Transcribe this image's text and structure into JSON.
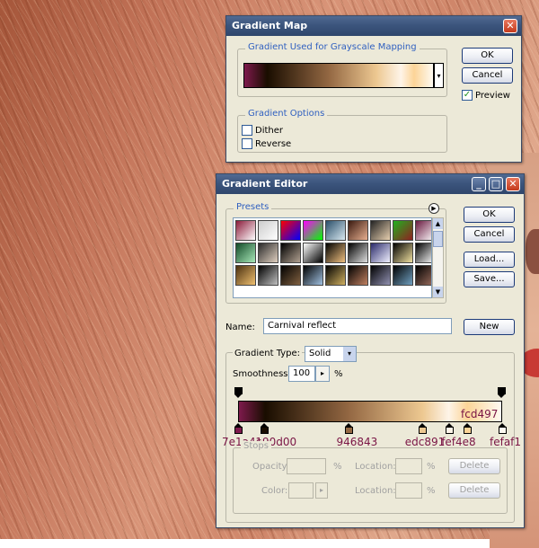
{
  "gradient_map": {
    "title": "Gradient Map",
    "used_label": "Gradient Used for Grayscale Mapping",
    "ok": "OK",
    "cancel": "Cancel",
    "preview_label": "Preview",
    "preview_checked": true,
    "options_label": "Gradient Options",
    "dither_label": "Dither",
    "dither_checked": false,
    "reverse_label": "Reverse",
    "reverse_checked": false
  },
  "gradient_editor": {
    "title": "Gradient Editor",
    "presets_label": "Presets",
    "ok": "OK",
    "cancel": "Cancel",
    "load": "Load...",
    "save": "Save...",
    "name_label": "Name:",
    "name_value": "Carnival reflect",
    "new_button": "New",
    "type_label": "Gradient Type:",
    "type_value": "Solid",
    "smoothness_label": "Smoothness:",
    "smoothness_value": "100",
    "percent": "%",
    "stops_label": "Stops",
    "opacity_label": "Opacity:",
    "color_label": "Color:",
    "location_label": "Location:",
    "delete_label": "Delete"
  },
  "color_stops": [
    {
      "label": "7e1a4c",
      "color": "#7e1a4c"
    },
    {
      "label": "190d00",
      "color": "#190d00"
    },
    {
      "label": "946843",
      "color": "#946843"
    },
    {
      "label": "edc891",
      "color": "#edc891"
    },
    {
      "label": "fef4e8",
      "color": "#fef4e8"
    },
    {
      "label": "fcd497",
      "color": "#fcd497"
    },
    {
      "label": "fefaf1",
      "color": "#fefaf1"
    }
  ],
  "colors": {
    "accent_blue": "#3060c0",
    "title_bar": "#3c557d",
    "stop_label": "#7a1545"
  }
}
